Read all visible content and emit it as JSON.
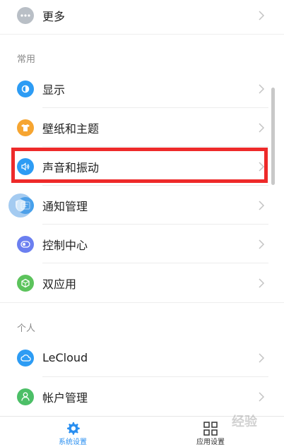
{
  "colors": {
    "accent": "#2a8ff0",
    "icon_more": "#b9bfc6",
    "icon_display": "#2d9cf4",
    "icon_wallpaper": "#f6a531",
    "icon_sound": "#2d9cf4",
    "icon_notification": "#3fa0ee",
    "icon_control": "#6b7ff0",
    "icon_dual": "#5cc35c",
    "icon_cloud": "#2d9cf4",
    "icon_account": "#4cbf67",
    "highlight_border": "#ee2a2a"
  },
  "top_item": {
    "label": "更多",
    "icon": "more-icon"
  },
  "sections": {
    "common": "常用",
    "personal": "个人"
  },
  "common_items": [
    {
      "label": "显示",
      "icon": "display-icon"
    },
    {
      "label": "壁纸和主题",
      "icon": "wallpaper-icon"
    },
    {
      "label": "声音和振动",
      "icon": "sound-icon"
    },
    {
      "label": "通知管理",
      "icon": "notification-icon"
    },
    {
      "label": "控制中心",
      "icon": "control-center-icon"
    },
    {
      "label": "双应用",
      "icon": "dual-app-icon"
    }
  ],
  "personal_items": [
    {
      "label": "LeCloud",
      "icon": "cloud-icon"
    },
    {
      "label": "帐户管理",
      "icon": "account-icon"
    }
  ],
  "tabbar": {
    "system_settings": "系统设置",
    "app_settings": "应用设置"
  },
  "watermark": "经验"
}
